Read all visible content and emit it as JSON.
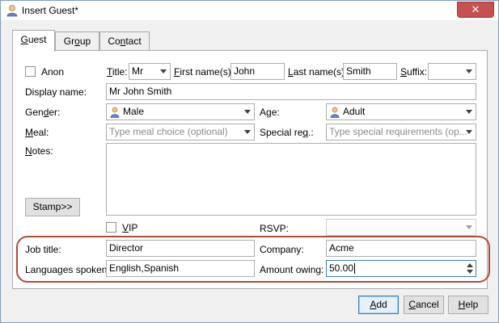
{
  "window": {
    "title": "Insert Guest*",
    "close_glyph": "✕"
  },
  "tabs": [
    {
      "before": "",
      "mnemonic": "G",
      "after": "uest",
      "active": true
    },
    {
      "before": "Gr",
      "mnemonic": "o",
      "after": "up",
      "active": false
    },
    {
      "before": "Co",
      "mnemonic": "n",
      "after": "tact",
      "active": false
    }
  ],
  "form": {
    "anon_label": "Anon",
    "title_label": {
      "before": "",
      "mnemonic": "T",
      "after": "itle:"
    },
    "title_value": "Mr",
    "first_name_label": {
      "before": "",
      "mnemonic": "F",
      "after": "irst name(s):"
    },
    "first_name_value": "John",
    "last_name_label": {
      "before": "",
      "mnemonic": "L",
      "after": "ast name(s):"
    },
    "last_name_value": "Smith",
    "suffix_label": {
      "before": "",
      "mnemonic": "S",
      "after": "uffix:"
    },
    "suffix_value": "",
    "display_name_label": "Display name:",
    "display_name_value": "Mr John Smith",
    "gender_label": {
      "before": "Gen",
      "mnemonic": "d",
      "after": "er:"
    },
    "gender_value": "Male",
    "age_label": {
      "before": "A",
      "mnemonic": "g",
      "after": "e:"
    },
    "age_value": "Adult",
    "meal_label": {
      "before": "",
      "mnemonic": "M",
      "after": "eal:"
    },
    "meal_placeholder": "Type meal choice (optional)",
    "special_req_label": {
      "before": "Special re",
      "mnemonic": "q",
      "after": ".:"
    },
    "special_req_placeholder": "Type special requirements (op...",
    "notes_label": {
      "before": "",
      "mnemonic": "N",
      "after": "otes:"
    },
    "notes_value": "",
    "stamp_label": "Stamp>>",
    "vip_label": {
      "before": "",
      "mnemonic": "V",
      "after": "IP"
    },
    "rsvp_label": "RSVP:",
    "rsvp_value": "",
    "job_title_label": "Job title:",
    "job_title_value": "Director",
    "company_label": "Company:",
    "company_value": "Acme",
    "languages_label": "Languages spoken:",
    "languages_value": "English,Spanish",
    "amount_owing_label": "Amount owing:",
    "amount_owing_value": "50.00"
  },
  "buttons": {
    "add": {
      "before": "",
      "mnemonic": "A",
      "after": "dd"
    },
    "cancel": {
      "before": "",
      "mnemonic": "C",
      "after": "ancel"
    },
    "help": {
      "before": "",
      "mnemonic": "H",
      "after": "elp"
    }
  },
  "colors": {
    "highlight_border": "#b04a3a",
    "close_button": "#c75050",
    "focus_border": "#3c7fb1"
  },
  "icons": {
    "app": "person-icon",
    "gender": "person-icon",
    "age": "person-icon"
  }
}
